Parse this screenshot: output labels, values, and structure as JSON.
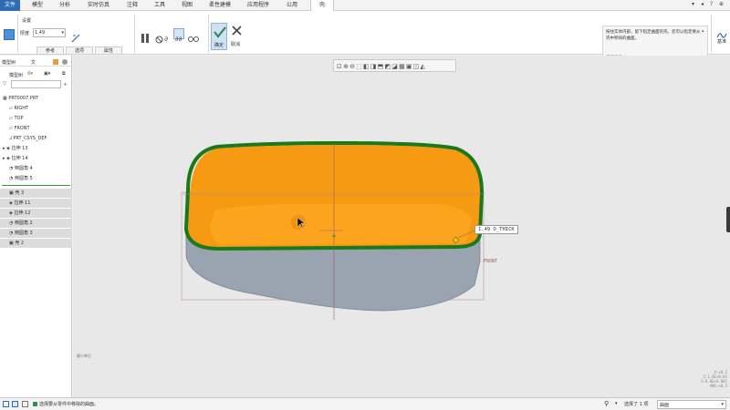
{
  "menu": {
    "tabs": [
      "文件",
      "模型",
      "分析",
      "实时仿真",
      "注释",
      "工具",
      "视图",
      "柔性建模",
      "应用程序",
      "公用",
      "壳"
    ]
  },
  "ribbon": {
    "settings_label": "设置",
    "thickness_label": "厚度",
    "thickness_value": "1.49",
    "subtabs": [
      "参考",
      "选项",
      "属性"
    ],
    "confirm_label": "确定",
    "cancel_label": "取消",
    "message": "按住实体内部，留下指定曲面的壳。您可以指定要从壳中移除的曲面。",
    "learn_more": "阅读更多...",
    "datum_label": "基准"
  },
  "left_panel": {
    "tab_model_tree": "模型树",
    "tab_files": "文",
    "tree_header": "模型树",
    "items": [
      {
        "label": "PRT0007.PRT",
        "icon": "part-icon"
      },
      {
        "label": "RIGHT",
        "icon": "plane-icon"
      },
      {
        "label": "TOP",
        "icon": "plane-icon"
      },
      {
        "label": "FRONT",
        "icon": "plane-icon"
      },
      {
        "label": "PRT_CSYS_DEF",
        "icon": "csys-icon"
      },
      {
        "label": "拉伸 13",
        "icon": "extrude-icon"
      },
      {
        "label": "拉伸 14",
        "icon": "extrude-icon"
      },
      {
        "label": "倒圆角 4",
        "icon": "round-icon"
      },
      {
        "label": "倒圆角 5",
        "icon": "round-icon"
      },
      {
        "label": "壳 3",
        "icon": "shell-icon"
      },
      {
        "label": "拉伸 11",
        "icon": "extrude-icon"
      },
      {
        "label": "拉伸 12",
        "icon": "extrude-icon"
      },
      {
        "label": "倒圆角 2",
        "icon": "round-icon"
      },
      {
        "label": "倒圆角 3",
        "icon": "round-icon"
      },
      {
        "label": "壳 2",
        "icon": "shell-icon"
      }
    ]
  },
  "graphics": {
    "dimension_label": "1.49 O_THICK",
    "front_label": "FRONT",
    "coord_text": "X: 0.1",
    "readout_lines": [
      "X:+0.1",
      "Z:1.0E+0.01",
      "S:0.0E+0.001",
      "ANG:+0.5"
    ],
    "scale_text": "最小单位"
  },
  "status": {
    "message": "选择要从零件中移除的曲面。",
    "selection": "选择了 1 项",
    "filter": "曲面"
  },
  "colors": {
    "accent": "#2e6db5",
    "shell_inner": "#f59a12",
    "shell_outer": "#9aa3b0",
    "highlight": "#1a7a1a"
  }
}
